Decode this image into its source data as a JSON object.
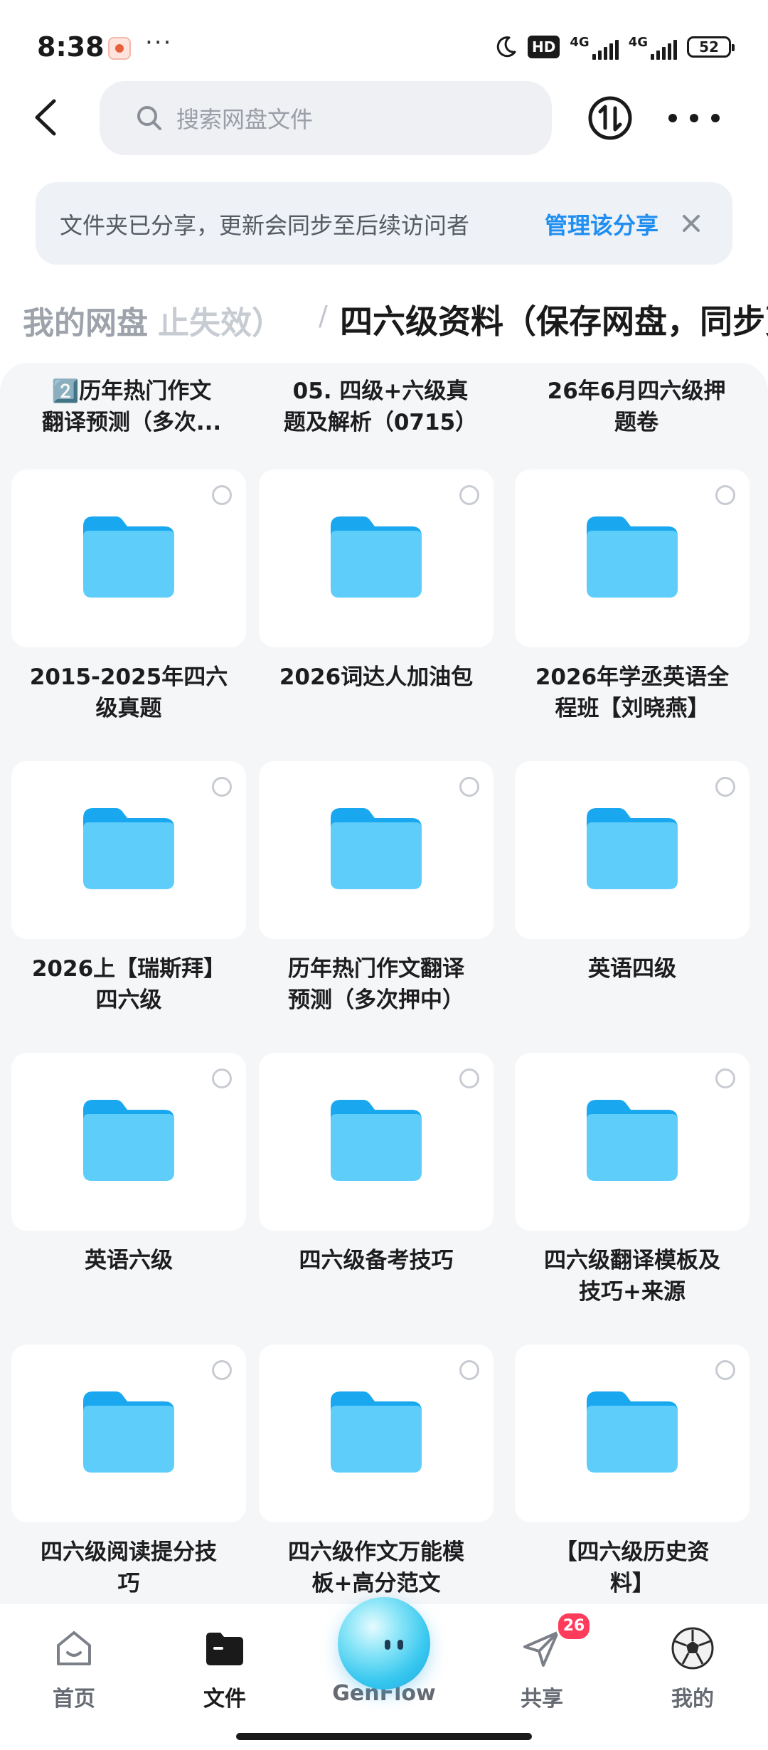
{
  "status_bar": {
    "time": "8:38",
    "hd_label": "HD",
    "net1": "4G",
    "net2": "4G",
    "battery": "52"
  },
  "search": {
    "placeholder": "搜索网盘文件"
  },
  "share_banner": {
    "text": "文件夹已分享，更新会同步至后续访问者",
    "manage_label": "管理该分享"
  },
  "breadcrumb": {
    "root": "我的网盘",
    "middle": "止失效）",
    "separator": "/",
    "current": "四六级资料（保存网盘，同步更"
  },
  "partial_row": [
    {
      "label": "2️⃣历年热门作文\n翻译预测（多次..."
    },
    {
      "label": "05. 四级+六级真\n题及解析（0715）"
    },
    {
      "label": "26年6月四六级押\n题卷"
    }
  ],
  "folders": [
    {
      "name": "2015-2025年四六\n级真题"
    },
    {
      "name": "2026词达人加油包"
    },
    {
      "name": "2026年学丞英语全\n程班【刘晓燕】"
    },
    {
      "name": "2026上【瑞斯拜】\n四六级"
    },
    {
      "name": "历年热门作文翻译\n预测（多次押中）"
    },
    {
      "name": "英语四级"
    },
    {
      "name": "英语六级"
    },
    {
      "name": "四六级备考技巧"
    },
    {
      "name": "四六级翻译模板及\n技巧+来源"
    },
    {
      "name": "四六级阅读提分技\n巧"
    },
    {
      "name": "四六级作文万能模\n板+高分范文"
    },
    {
      "name": "【四六级历史资\n料】"
    }
  ],
  "bottom_nav": {
    "items": [
      {
        "label": "首页",
        "icon": "home-face-icon"
      },
      {
        "label": "文件",
        "icon": "folder-icon"
      },
      {
        "label": "GenFlow",
        "icon": "genflow-orb-icon"
      },
      {
        "label": "共享",
        "icon": "paper-plane-icon"
      },
      {
        "label": "我的",
        "icon": "soccer-avatar-icon"
      }
    ],
    "share_badge": "26",
    "active_index": 1
  },
  "colors": {
    "accent": "#1f8ef1",
    "folder_top": "#19a7f0",
    "folder_front": "#5ecdfa",
    "badge": "#ff3b5c"
  }
}
